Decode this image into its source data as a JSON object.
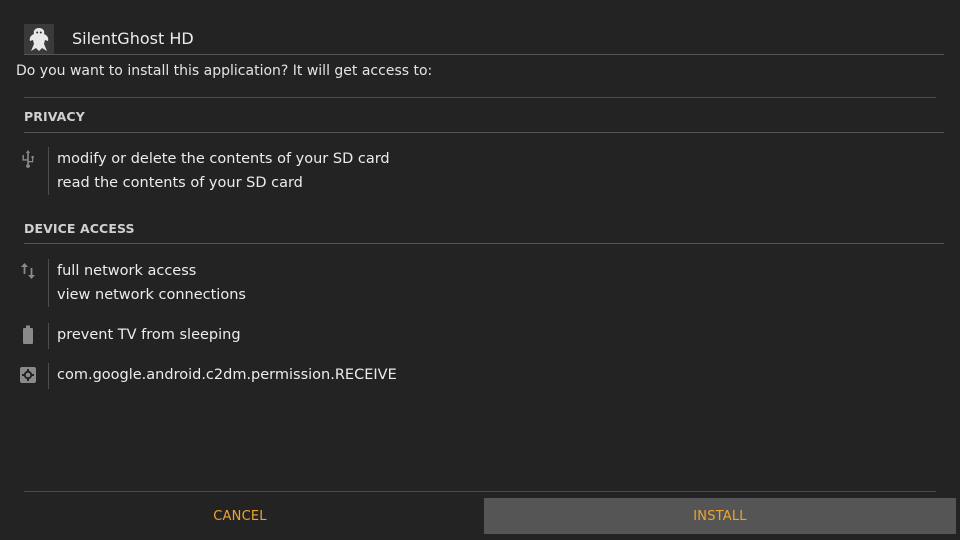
{
  "app": {
    "name": "SilentGhost HD",
    "icon": "ghost-app-icon"
  },
  "prompt": "Do you want to install this application? It will get access to:",
  "sections": {
    "privacy": {
      "title": "PRIVACY",
      "groups": [
        {
          "icon": "usb-icon",
          "lines": [
            "modify or delete the contents of your SD card",
            "read the contents of your SD card"
          ]
        }
      ]
    },
    "device_access": {
      "title": "DEVICE ACCESS",
      "groups": [
        {
          "icon": "network-arrows-icon",
          "lines": [
            "full network access",
            "view network connections"
          ]
        },
        {
          "icon": "battery-icon",
          "lines": [
            "prevent TV from sleeping"
          ]
        },
        {
          "icon": "gear-icon",
          "lines": [
            "com.google.android.c2dm.permission.RECEIVE"
          ]
        }
      ]
    }
  },
  "buttons": {
    "cancel": "CANCEL",
    "install": "INSTALL"
  },
  "colors": {
    "background": "#232323",
    "accent": "#f0a330",
    "install_button_bg": "#555555",
    "divider": "#4a4a4a"
  }
}
